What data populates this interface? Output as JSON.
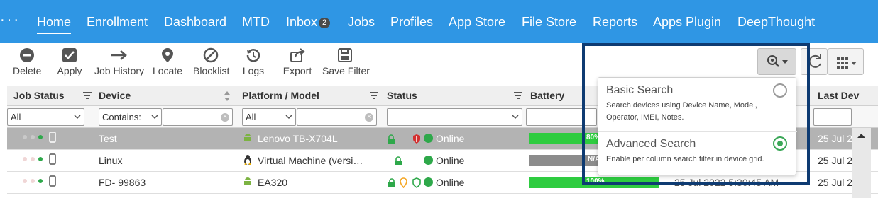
{
  "nav": {
    "dots": "···",
    "items": [
      {
        "label": "Home"
      },
      {
        "label": "Enrollment"
      },
      {
        "label": "Dashboard"
      },
      {
        "label": "MTD"
      },
      {
        "label": "Inbox",
        "badge": "2"
      },
      {
        "label": "Jobs"
      },
      {
        "label": "Profiles"
      },
      {
        "label": "App Store"
      },
      {
        "label": "File Store"
      },
      {
        "label": "Reports"
      },
      {
        "label": "Apps Plugin"
      },
      {
        "label": "DeepThought"
      }
    ],
    "active": "Home"
  },
  "toolbar": {
    "buttons": [
      {
        "label": "Delete",
        "icon": "delete-icon"
      },
      {
        "label": "Apply",
        "icon": "checkbox-icon"
      },
      {
        "label": "Job History",
        "icon": "arrow-right-icon"
      },
      {
        "label": "Locate",
        "icon": "map-pin-icon"
      },
      {
        "label": "Blocklist",
        "icon": "block-icon"
      },
      {
        "label": "Logs",
        "icon": "history-icon"
      },
      {
        "label": "Export",
        "icon": "share-icon"
      },
      {
        "label": "Save Filter",
        "icon": "save-icon"
      }
    ]
  },
  "grid": {
    "columns": [
      "Job Status",
      "Device",
      "Platform / Model",
      "Status",
      "Battery",
      "Last Dev"
    ],
    "filters": {
      "job_status": "All",
      "device_mode": "Contains:",
      "platform": "All"
    },
    "rows": [
      {
        "device": "Test",
        "platform": "Lenovo TB-X704L",
        "platform_icon": "android-icon",
        "status": "Online",
        "battery": "80%",
        "battery_level": 80,
        "last": "25 Jul 2",
        "selected": true
      },
      {
        "device": "Linux",
        "platform": "Virtual Machine (versi…",
        "platform_icon": "linux-icon",
        "status": "Online",
        "battery": "N/A",
        "battery_level": 100,
        "last": "25 Jul 2",
        "selected": false
      },
      {
        "device": "FD- 99863",
        "platform": "EA320",
        "platform_icon": "android-icon",
        "status": "Online",
        "battery": "100%",
        "battery_level": 100,
        "last": "25 Jul 2",
        "last_mid": "25 Jul 2022 5:30:45 AM",
        "selected": false
      }
    ]
  },
  "search_menu": {
    "basic": {
      "title": "Basic Search",
      "desc": "Search devices using Device Name, Model, Operator, IMEI, Notes.",
      "selected": false
    },
    "advanced": {
      "title": "Advanced Search",
      "desc": "Enable per column search filter in device grid.",
      "selected": true
    }
  },
  "colors": {
    "nav": "#2f96e4",
    "highlight": "#0e3b72",
    "battery": "#2ecc40",
    "selected_row": "#b3b3b3"
  }
}
